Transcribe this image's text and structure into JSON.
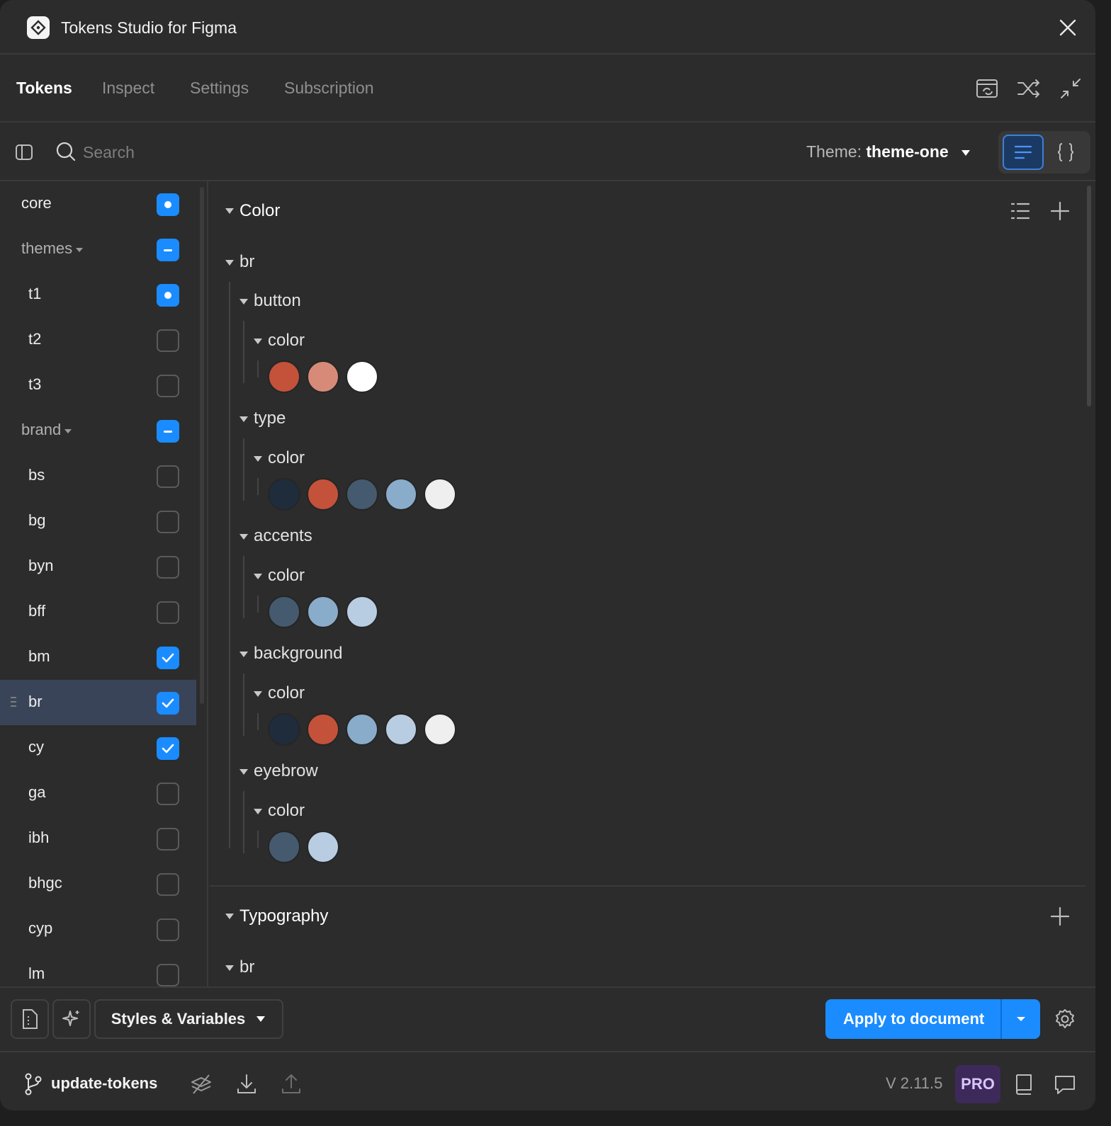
{
  "app": {
    "title": "Tokens Studio for Figma"
  },
  "tabs": [
    "Tokens",
    "Inspect",
    "Settings",
    "Subscription"
  ],
  "search": {
    "placeholder": "Search"
  },
  "theme": {
    "label": "Theme:",
    "value": "theme-one"
  },
  "sidebar": {
    "sets": [
      {
        "label": "core",
        "state": "dot",
        "folder": false
      },
      {
        "label": "themes",
        "state": "dash",
        "folder": true
      },
      {
        "label": "t1",
        "state": "dot",
        "folder": false
      },
      {
        "label": "t2",
        "state": "off",
        "folder": false
      },
      {
        "label": "t3",
        "state": "off",
        "folder": false
      },
      {
        "label": "brand",
        "state": "dash",
        "folder": true
      },
      {
        "label": "bs",
        "state": "off",
        "folder": false
      },
      {
        "label": "bg",
        "state": "off",
        "folder": false
      },
      {
        "label": "byn",
        "state": "off",
        "folder": false
      },
      {
        "label": "bff",
        "state": "off",
        "folder": false
      },
      {
        "label": "bm",
        "state": "check",
        "folder": false
      },
      {
        "label": "br",
        "state": "check",
        "folder": false,
        "selected": true
      },
      {
        "label": "cy",
        "state": "check",
        "folder": false
      },
      {
        "label": "ga",
        "state": "off",
        "folder": false
      },
      {
        "label": "ibh",
        "state": "off",
        "folder": false
      },
      {
        "label": "bhgc",
        "state": "off",
        "folder": false
      },
      {
        "label": "cyp",
        "state": "off",
        "folder": false
      },
      {
        "label": "lm",
        "state": "off",
        "folder": false
      }
    ]
  },
  "content": {
    "color_section": {
      "title": "Color",
      "root": "br",
      "groups": [
        {
          "label": "button",
          "sub": "color",
          "swatches": [
            "#c4523a",
            "#d88a78",
            "#ffffff"
          ]
        },
        {
          "label": "type",
          "sub": "color",
          "swatches": [
            "#1f2c3b",
            "#c4523a",
            "#455a6e",
            "#8aaccb",
            "#efefef"
          ]
        },
        {
          "label": "accents",
          "sub": "color",
          "swatches": [
            "#455a6e",
            "#8aaccb",
            "#b9cde2"
          ]
        },
        {
          "label": "background",
          "sub": "color",
          "swatches": [
            "#1f2c3b",
            "#c4523a",
            "#8aaccb",
            "#b9cde2",
            "#efefef"
          ]
        },
        {
          "label": "eyebrow",
          "sub": "color",
          "swatches": [
            "#455a6e",
            "#b9cde2"
          ]
        }
      ]
    },
    "typography_section": {
      "title": "Typography",
      "root": "br"
    }
  },
  "footer": {
    "styles_label": "Styles & Variables",
    "apply_label": "Apply to document",
    "branch": "update-tokens",
    "version": "V 2.11.5",
    "pro": "PRO"
  },
  "colors": {
    "accent": "#1a8cff",
    "selected_row": "#3a4459",
    "pro_bg": "#3d2a5a"
  }
}
